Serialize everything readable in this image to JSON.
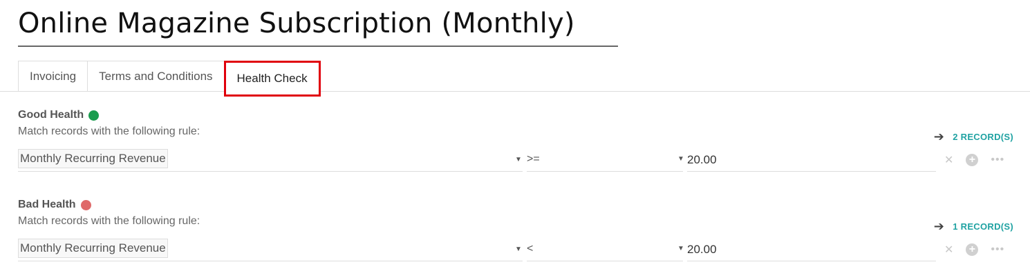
{
  "title": "Online Magazine Subscription (Monthly)",
  "tabs": [
    {
      "label": "Invoicing"
    },
    {
      "label": "Terms and Conditions"
    },
    {
      "label": "Health Check"
    }
  ],
  "active_tab": "Health Check",
  "good_health": {
    "heading": "Good Health",
    "dot_color": "#1a9c4e",
    "rule_text": "Match records with the following rule:",
    "records_label": "2 RECORD(S)",
    "field": "Monthly Recurring Revenue",
    "operator": ">=",
    "value": "20.00"
  },
  "bad_health": {
    "heading": "Bad Health",
    "dot_color": "#df6a6a",
    "rule_text": "Match records with the following rule:",
    "records_label": "1 RECORD(S)",
    "field": "Monthly Recurring Revenue",
    "operator": "<",
    "value": "20.00"
  },
  "icons": {
    "arrow": "arrow-right-icon",
    "delete": "close-icon",
    "add": "add-circle-icon",
    "more": "more-options-icon",
    "caret": "caret-down-icon"
  },
  "colors": {
    "accent": "#1fa2a2",
    "active_tab_border": "#e0000b"
  }
}
